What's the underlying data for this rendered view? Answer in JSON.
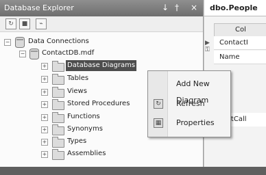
{
  "explorer": {
    "title": "Database Explorer",
    "pin_glyph": "↓",
    "float_glyph": "†",
    "close_glyph": "×",
    "toolbar": [
      "refresh-icon",
      "stop-refresh-icon",
      "connect-icon"
    ],
    "tree": {
      "root": "Data Connections",
      "db": "ContactDB.mdf",
      "folders": [
        "Database Diagrams",
        "Tables",
        "Views",
        "Stored Procedures",
        "Functions",
        "Synonyms",
        "Types",
        "Assemblies"
      ]
    }
  },
  "table_designer": {
    "tab_title": "dbo.People",
    "column_header": "Col",
    "rows": [
      "ContactI",
      "Name",
      "LastCall"
    ]
  },
  "context_menu": {
    "items": [
      {
        "label": "Add New Diagram",
        "icon": ""
      },
      {
        "label": "Refresh",
        "icon": "refresh-icon"
      },
      {
        "label": "Properties",
        "icon": "properties-icon"
      }
    ]
  }
}
